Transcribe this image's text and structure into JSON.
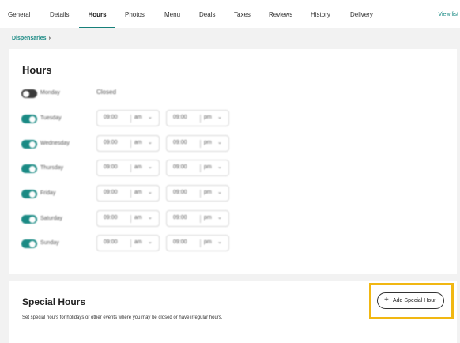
{
  "nav": {
    "tabs": [
      "General",
      "Details",
      "Hours",
      "Photos",
      "Menu",
      "Deals",
      "Taxes",
      "Reviews",
      "History",
      "Delivery"
    ],
    "active": "Hours",
    "view_list": "View list"
  },
  "breadcrumb": {
    "label": "Dispensaries",
    "chevron": "›"
  },
  "hours": {
    "title": "Hours",
    "days": [
      {
        "day": "Monday",
        "enabled": false,
        "closed_label": "Closed"
      },
      {
        "day": "Tuesday",
        "enabled": true,
        "open": "09:00",
        "open_meridiem": "am",
        "close": "09:00",
        "close_meridiem": "pm"
      },
      {
        "day": "Wednesday",
        "enabled": true,
        "open": "09:00",
        "open_meridiem": "am",
        "close": "09:00",
        "close_meridiem": "pm"
      },
      {
        "day": "Thursday",
        "enabled": true,
        "open": "09:00",
        "open_meridiem": "am",
        "close": "09:00",
        "close_meridiem": "pm"
      },
      {
        "day": "Friday",
        "enabled": true,
        "open": "09:00",
        "open_meridiem": "am",
        "close": "09:00",
        "close_meridiem": "pm"
      },
      {
        "day": "Saturday",
        "enabled": true,
        "open": "09:00",
        "open_meridiem": "am",
        "close": "09:00",
        "close_meridiem": "pm"
      },
      {
        "day": "Sunday",
        "enabled": true,
        "open": "09:00",
        "open_meridiem": "am",
        "close": "09:00",
        "close_meridiem": "pm"
      }
    ]
  },
  "special": {
    "title": "Special Hours",
    "description": "Set special hours for holidays or other events where you may be closed or have irregular hours.",
    "add_button": "Add Special Hour",
    "add_icon": "plus-icon"
  },
  "colors": {
    "accent": "#1a8a84",
    "highlight": "#f1b712"
  }
}
